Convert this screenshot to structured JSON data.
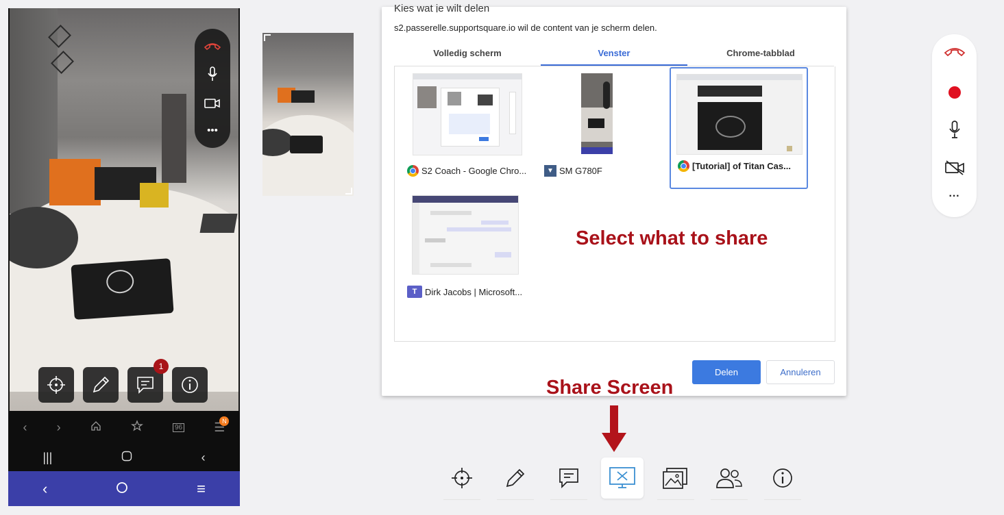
{
  "dialog": {
    "title": "Kies wat je wilt delen",
    "subtitle": "s2.passerelle.supportsquare.io wil de content van je scherm delen.",
    "tabs": [
      {
        "label": "Volledig scherm",
        "active": false
      },
      {
        "label": "Venster",
        "active": true
      },
      {
        "label": "Chrome-tabblad",
        "active": false
      }
    ],
    "items": [
      {
        "label": "S2 Coach - Google Chro...",
        "icon": "chrome-icon",
        "selected": false
      },
      {
        "label": "SM G780F",
        "icon": "sm-app-icon",
        "selected": false
      },
      {
        "label": "[Tutorial] of Titan Cas...",
        "icon": "chrome-icon",
        "selected": true
      },
      {
        "label": "Dirk Jacobs | Microsoft...",
        "icon": "teams-icon",
        "selected": false
      }
    ],
    "share_label": "Delen",
    "cancel_label": "Annuleren"
  },
  "annotations": {
    "select_text": "Select what to share",
    "share_screen_text": "Share Screen"
  },
  "phone": {
    "chat_badge": "1",
    "nav_badge": "N",
    "tab_count": "96"
  },
  "colors": {
    "accent": "#3c7ae0",
    "annotation": "#a9121a",
    "record": "#e01020",
    "hangup": "#d0302f",
    "nav_blue": "#3b3fa8"
  }
}
